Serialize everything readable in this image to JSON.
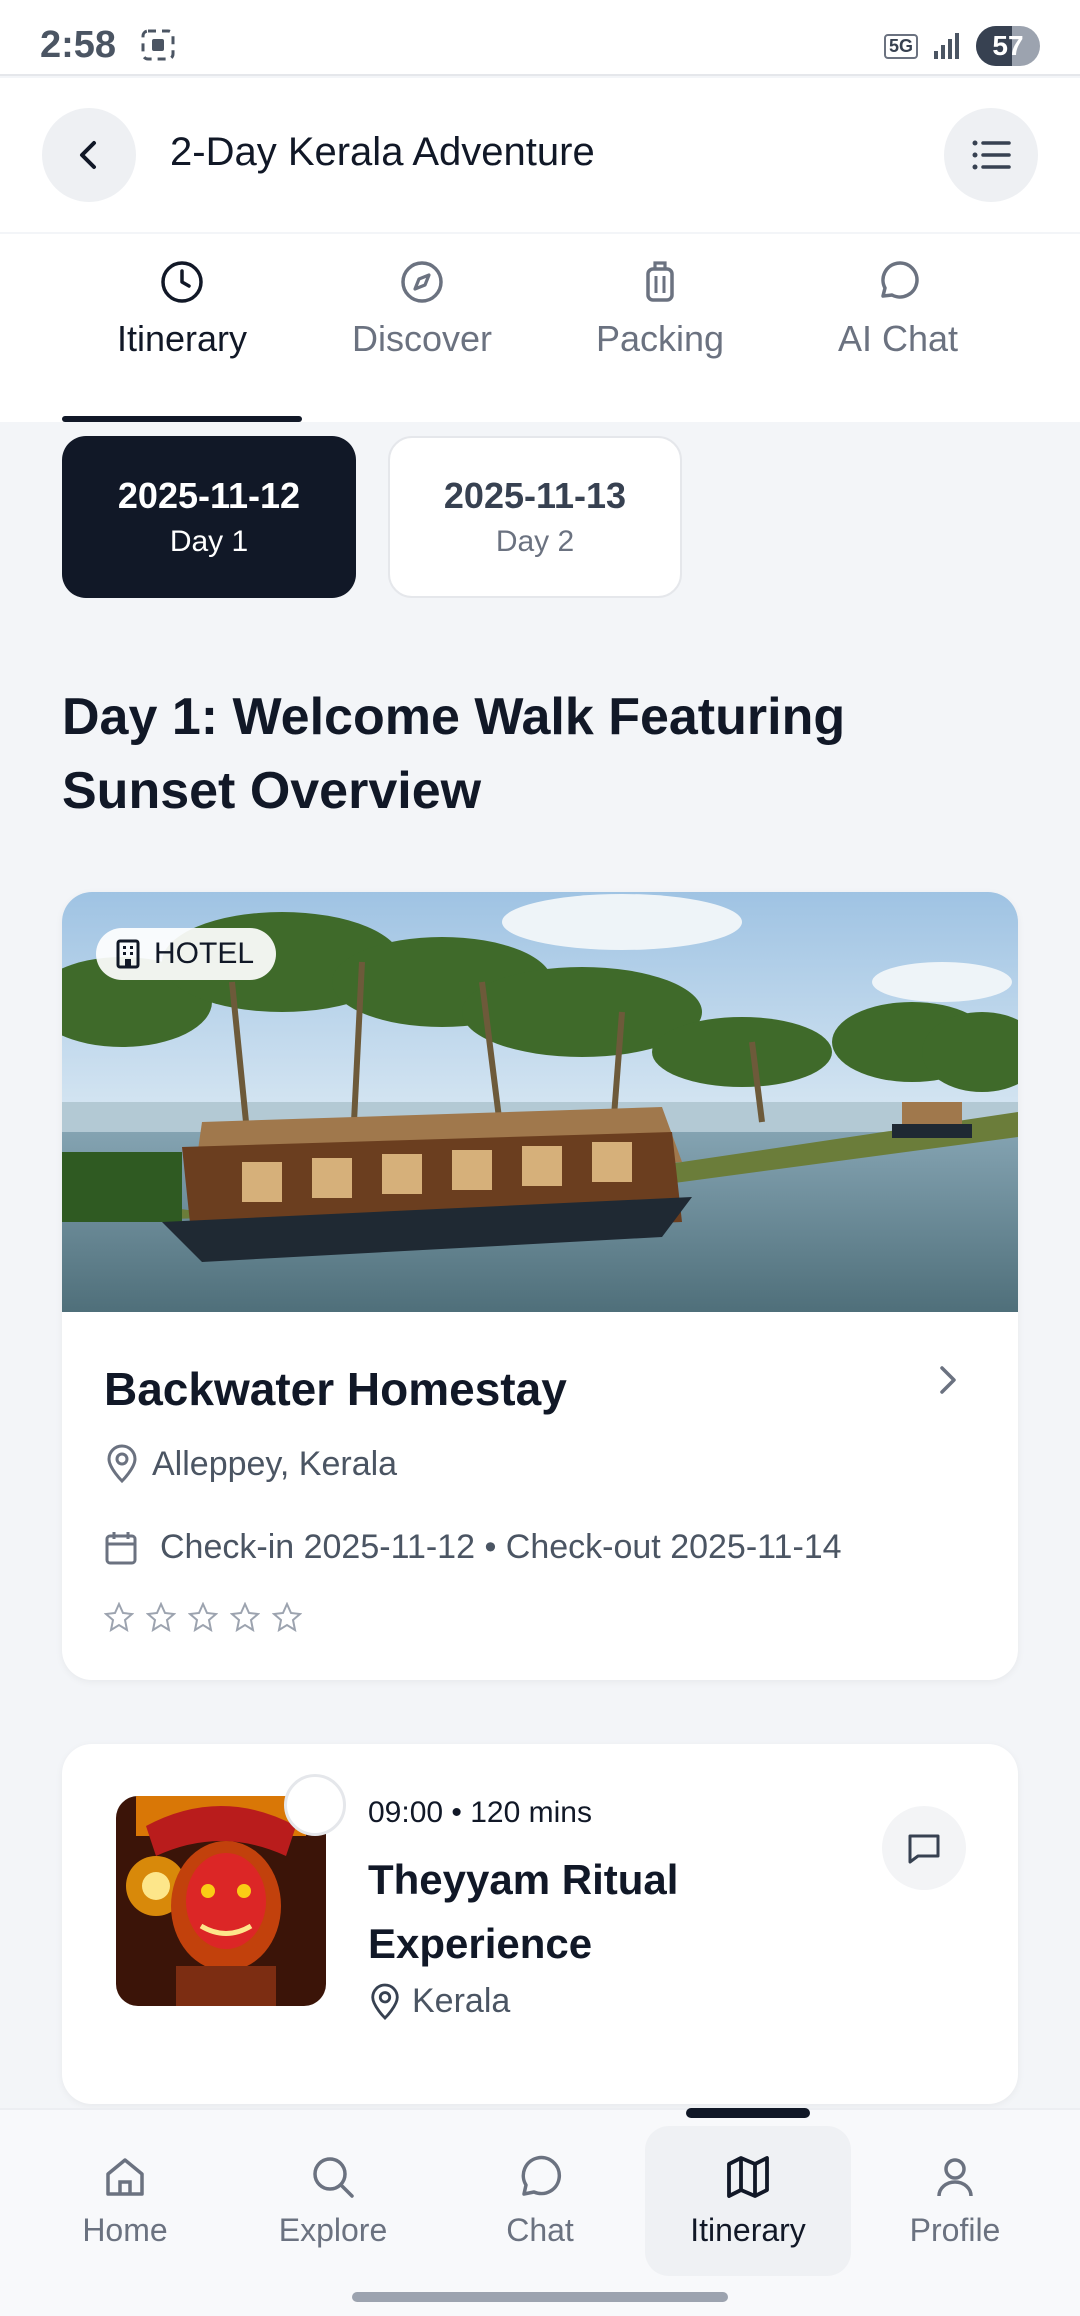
{
  "status_bar": {
    "time": "2:58",
    "network": "5G",
    "battery": "57",
    "battery_level": 0.57
  },
  "header": {
    "title": "2-Day Kerala Adventure"
  },
  "tabs": [
    {
      "label": "Itinerary",
      "icon": "clock-icon",
      "active": true
    },
    {
      "label": "Discover",
      "icon": "compass-icon",
      "active": false
    },
    {
      "label": "Packing",
      "icon": "luggage-icon",
      "active": false
    },
    {
      "label": "AI Chat",
      "icon": "chat-bubble-icon",
      "active": false
    }
  ],
  "days": [
    {
      "date": "2025-11-12",
      "label": "Day 1",
      "active": true
    },
    {
      "date": "2025-11-13",
      "label": "Day 2",
      "active": false
    }
  ],
  "day_title": "Day 1: Welcome Walk Featuring Sunset Overview",
  "hotel": {
    "badge": "HOTEL",
    "name": "Backwater Homestay",
    "location": "Alleppey, Kerala",
    "dates": "Check-in 2025-11-12 • Check-out 2025-11-14",
    "rating": 0,
    "max_rating": 5
  },
  "activity": {
    "time": "09:00 • 120 mins",
    "title": "Theyyam Ritual Experience",
    "location": "Kerala"
  },
  "bottom_nav": [
    {
      "label": "Home",
      "icon": "home-icon",
      "active": false
    },
    {
      "label": "Explore",
      "icon": "search-icon",
      "active": false
    },
    {
      "label": "Chat",
      "icon": "chat-icon",
      "active": false
    },
    {
      "label": "Itinerary",
      "icon": "map-icon",
      "active": true
    },
    {
      "label": "Profile",
      "icon": "profile-icon",
      "active": false
    }
  ],
  "colors": {
    "primary": "#111827",
    "background": "#f3f5f8",
    "muted_text": "#6b7280"
  }
}
